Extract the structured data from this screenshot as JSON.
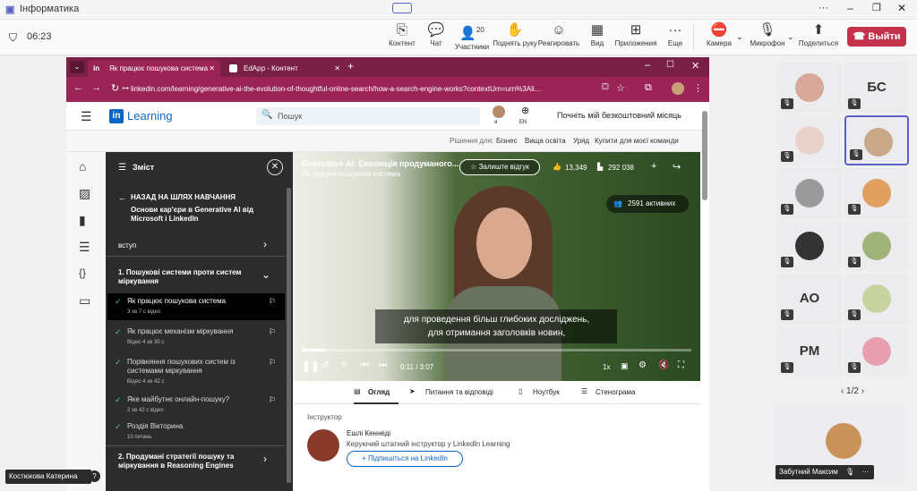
{
  "window": {
    "title": "Інформатика"
  },
  "meeting": {
    "timer": "06:23",
    "toolbar": [
      {
        "label": "Контент",
        "icon": "share-content-icon"
      },
      {
        "label": "Чат",
        "icon": "chat-icon"
      },
      {
        "label": "Участники",
        "icon": "people-icon",
        "count": "20"
      },
      {
        "label": "Поднять руку",
        "icon": "hand-icon"
      },
      {
        "label": "Реагировать",
        "icon": "smile-icon"
      },
      {
        "label": "Вид",
        "icon": "grid-icon"
      },
      {
        "label": "Приложения",
        "icon": "plus-icon"
      },
      {
        "label": "Еще",
        "icon": "more-icon"
      },
      {
        "label": "Камера",
        "icon": "camera-off-icon"
      },
      {
        "label": "Микрофон",
        "icon": "mic-off-icon"
      },
      {
        "label": "Поделиться",
        "icon": "share-icon"
      }
    ],
    "leave_label": "Выйти",
    "presenter_name": "Костюкова Катерина",
    "self_name": "Забутний Максим",
    "pager": "1/2",
    "tiles": [
      {
        "type": "photo",
        "color": "#d8a89a"
      },
      {
        "type": "initials",
        "text": "БС"
      },
      {
        "type": "photo",
        "color": "#e9d2c9"
      },
      {
        "type": "photo",
        "color": "#c9a88a"
      },
      {
        "type": "photo",
        "color": "#9a9a9a"
      },
      {
        "type": "photo",
        "color": "#e0a060"
      },
      {
        "type": "photo",
        "color": "#333333"
      },
      {
        "type": "photo",
        "color": "#9fb37a"
      },
      {
        "type": "initials",
        "text": "АО"
      },
      {
        "type": "photo",
        "color": "#c8d4a0"
      },
      {
        "type": "initials",
        "text": "PM"
      },
      {
        "type": "photo",
        "color": "#e8a0b0"
      }
    ]
  },
  "browser": {
    "tabs": [
      "Як працює пошукова система",
      "EdApp - Контент"
    ],
    "url": "linkedin.com/learning/generative-ai-the-evolution-of-thoughtful-online-search/how-a-search-engine-works?contextUrn=urn%3Ali..."
  },
  "linkedin": {
    "logo_in": "in",
    "logo_text": "Learning",
    "search_placeholder": "Пошук",
    "user_menu": "я",
    "lang": "EN",
    "trial": "Почніть мій безкоштовний місяць",
    "solutions": [
      "Рішення для:",
      "Бізнес",
      "Вища освіта",
      "Уряд",
      "Купити для моєї команди"
    ],
    "toc": {
      "header": "Зміст",
      "back": "НАЗАД НА ШЛЯХ НАВЧАННЯ",
      "path": "Основи кар'єри в Generative AI від Microsoft і LinkedIn",
      "intro": "вступ",
      "chapter1": "1. Пошукові системи проти систем міркування",
      "items": [
        {
          "title": "Як працює пошукова система",
          "meta": "3 хв 7 с відео"
        },
        {
          "title": "Як працює механізм міркування",
          "meta": "Відео 4 хв 30 с"
        },
        {
          "title": "Порівняння пошукових систем із системами міркування",
          "meta": "Відео 4 хв 42 с"
        },
        {
          "title": "Яке майбутнє онлайн-пошуку?",
          "meta": "2 хв 42 с відео"
        },
        {
          "title": "Роздія Вікторина",
          "meta": "10 питань"
        }
      ],
      "chapter2": "2. Продумані стратегії пошуку та міркування в Reasoning Engines"
    },
    "video": {
      "course": "Generative AI: Еволюція продуманого...",
      "lesson": "Як працює пошукова система",
      "review": "Залиште відгук",
      "likes": "13,349",
      "learners": "292 038",
      "active": "2591 активних",
      "subtitle1": "для проведення більш глибоких досліджень,",
      "subtitle2": "для отримання заголовків новин,",
      "time": "0:11 / 3:07",
      "speed": "1x",
      "progress": 0.06
    },
    "tabs": [
      "Огляд",
      "Питання та відповіді",
      "Ноутбук",
      "Стенограма"
    ],
    "instructor": {
      "section": "Інструктор",
      "name": "Ешлі Кеннеді",
      "role": "Керуючий штатний інструктор у LinkedIn Learning",
      "follow": "Підпишіться на LinkedIn"
    }
  }
}
